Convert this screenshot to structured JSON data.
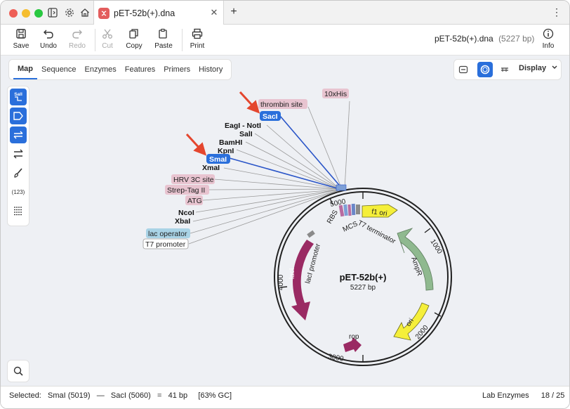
{
  "window": {
    "tab_title": "pET-52b(+).dna",
    "close_glyph": "✕",
    "add_glyph": "+",
    "menu_glyph": "⋮"
  },
  "toolbar": {
    "save": "Save",
    "undo": "Undo",
    "redo": "Redo",
    "cut": "Cut",
    "copy": "Copy",
    "paste": "Paste",
    "print": "Print",
    "info": "Info",
    "doc_name": "pET-52b(+).dna",
    "doc_size": "(5227 bp)"
  },
  "view_tabs": [
    "Map",
    "Sequence",
    "Enzymes",
    "Features",
    "Primers",
    "History"
  ],
  "display_label": "Display",
  "side_tool_count_label": "(123)",
  "side_tool_sal_label": "SalI",
  "map": {
    "name": "pET-52b(+)",
    "length": "5227 bp",
    "ticks": [
      "1000",
      "2000",
      "3000",
      "4000",
      "5000"
    ],
    "features": {
      "f1_ori": "f1 ori",
      "ampr": "AmpR",
      "ori": "ori",
      "rop": "rop",
      "laci": "lacI",
      "laci_promoter": "lacI promoter",
      "t7_terminator": "T7 terminator",
      "rbs": "RBS",
      "mcs": "MCS"
    },
    "labels": {
      "his": "10xHis",
      "thrombin": "thrombin site",
      "saci": "SacI",
      "eagi_noti": "EagI - NotI",
      "sali": "SalI",
      "bamhi": "BamHI",
      "kpni": "KpnI",
      "smai": "SmaI",
      "xmai": "XmaI",
      "hrv": "HRV 3C site",
      "strep": "Strep-Tag II",
      "atg": "ATG",
      "ncoi": "NcoI",
      "xbai": "XbaI",
      "lac_operator": "lac operator",
      "t7_promoter": "T7 promoter"
    }
  },
  "status": {
    "selected_label": "Selected:",
    "start": "SmaI (5019)",
    "dash": "—",
    "end": "SacI (5060)",
    "equals": "=",
    "bp": "41 bp",
    "gc": "[63% GC]",
    "enzyme_set": "Lab Enzymes",
    "count": "18 / 25"
  },
  "colors": {
    "accent": "#2a6fdb",
    "feature_label_bg": "#e8c4d0",
    "lac_operator_bg": "#a9d3e6",
    "f1_ori": "#f5ef3a",
    "ampr": "#8fb98f",
    "laci": "#9a2a63"
  }
}
